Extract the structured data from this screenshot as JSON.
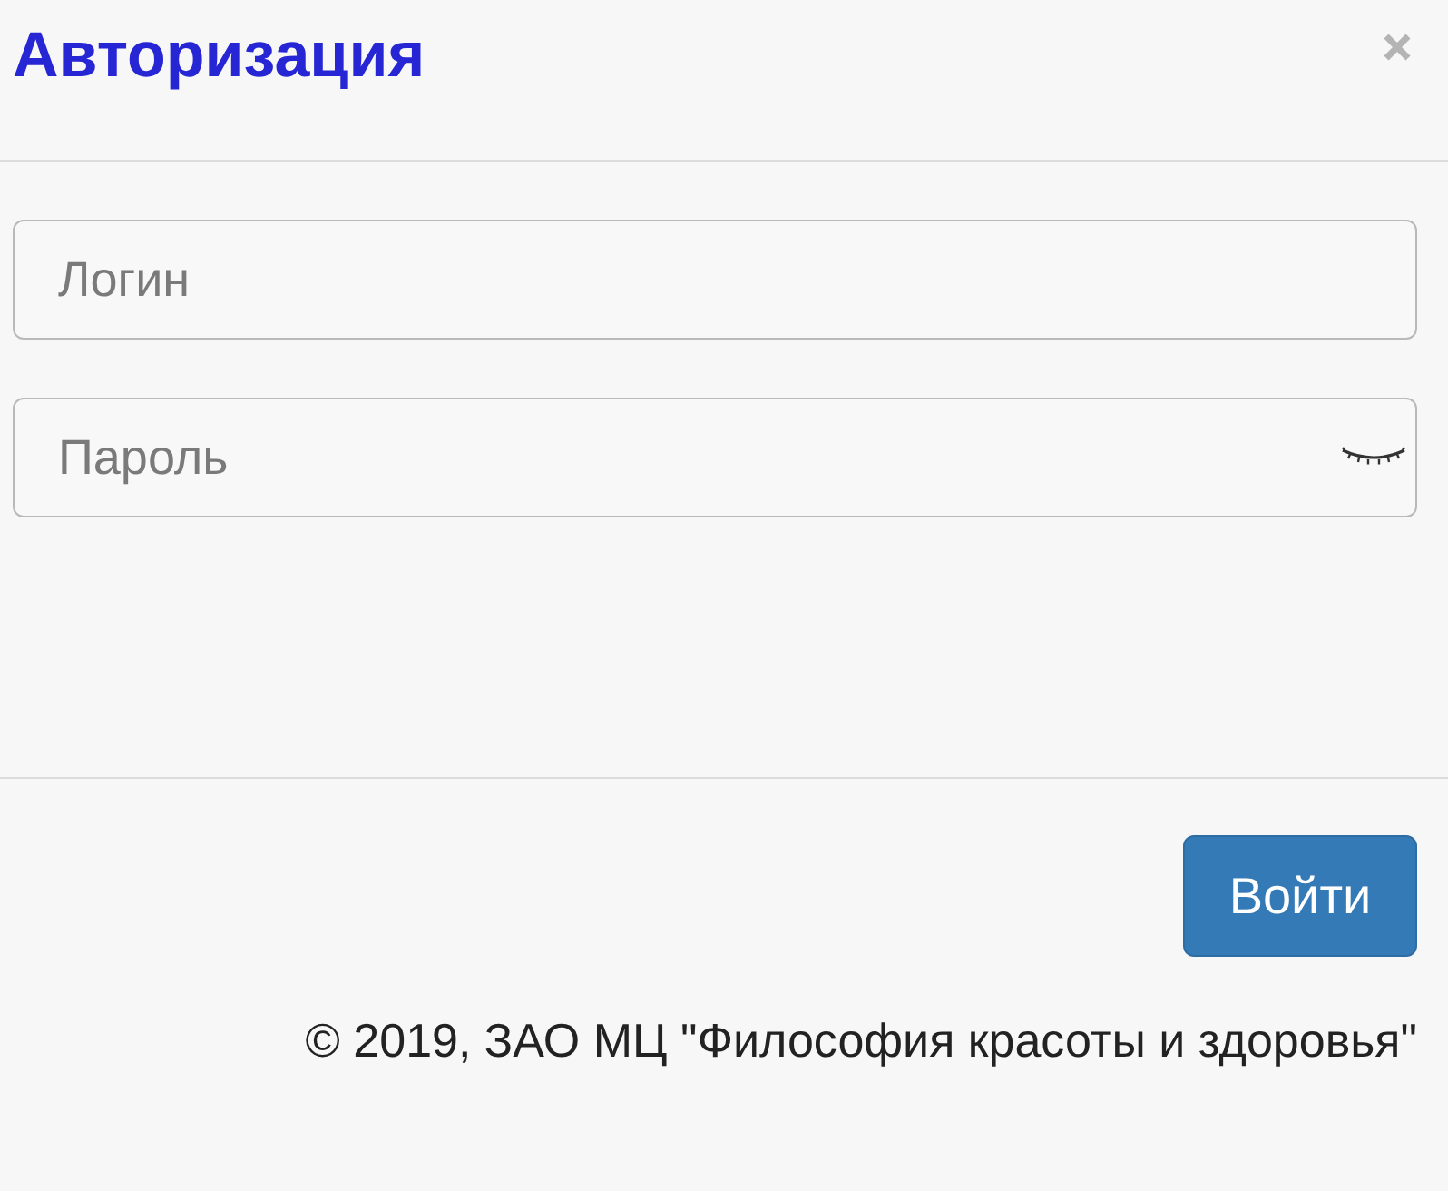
{
  "dialog": {
    "title": "Авторизация",
    "closable": true
  },
  "fields": [
    {
      "kind": "text",
      "placeholder": "Логин"
    },
    {
      "kind": "password",
      "placeholder": "Пароль",
      "password_visible": false
    }
  ],
  "submit_button": {
    "label": "Войти"
  },
  "footer": {
    "copyright": "© 2019, ЗАО МЦ \"Философия красоты и здоровья\""
  }
}
